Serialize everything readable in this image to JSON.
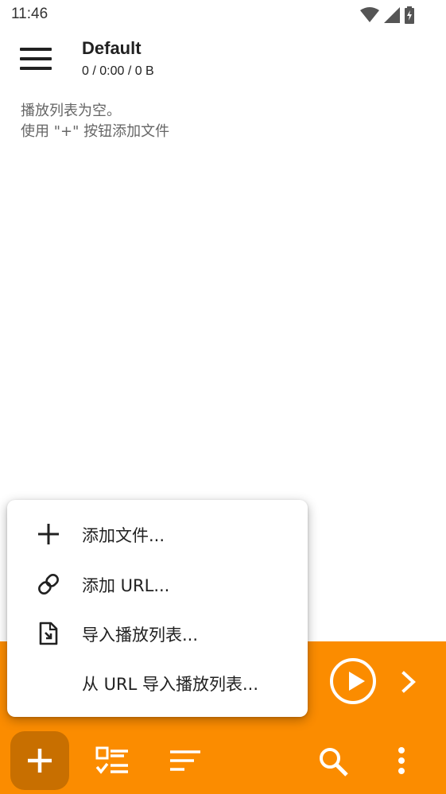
{
  "status_bar": {
    "time": "11:46",
    "icons": [
      "wifi-icon",
      "signal-icon",
      "battery-charging-icon"
    ]
  },
  "header": {
    "title": "Default",
    "subtitle": "0 / 0:00 / 0 B",
    "menu_icon": "hamburger-menu-icon"
  },
  "empty_state": {
    "line1": "播放列表为空。",
    "line2": "使用 \"+\" 按钮添加文件"
  },
  "popup_menu": {
    "items": [
      {
        "label": "添加文件...",
        "icon": "plus-icon"
      },
      {
        "label": "添加 URL...",
        "icon": "link-icon"
      },
      {
        "label": "导入播放列表...",
        "icon": "import-file-icon"
      },
      {
        "label": "从 URL 导入播放列表...",
        "icon": ""
      }
    ]
  },
  "player_bar": {
    "accent_color": "#fb8c00",
    "play_icon": "play-circle-icon",
    "next_icon": "chevron-right-icon"
  },
  "bottom_toolbar": {
    "buttons": [
      "add-icon",
      "checklist-icon",
      "sort-icon",
      "search-icon",
      "more-vertical-icon"
    ]
  }
}
